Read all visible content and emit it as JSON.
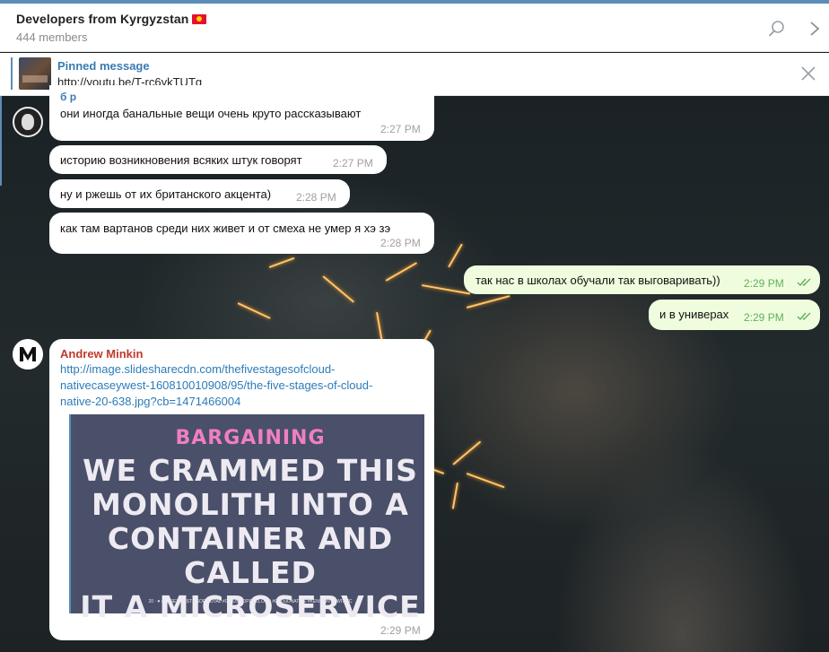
{
  "header": {
    "title": "Developers from Kyrgyzstan",
    "members": "444 members",
    "flag_color": "#e8112d"
  },
  "pinned": {
    "title": "Pinned message",
    "text": "http://youtu.be/T-rc6ykTUTg"
  },
  "messages": [
    {
      "sender_partial": "б р",
      "text": "они иногда банальные вещи очень круто рассказывают",
      "time": "2:27 PM"
    },
    {
      "text": "историю возникновения всяких штук говорят",
      "time": "2:27 PM"
    },
    {
      "text": "ну и ржешь от их британского акцента)",
      "time": "2:28 PM"
    },
    {
      "text": "как там вартанов среди них живет и от смеха не умер я хэ зэ",
      "time": "2:28 PM"
    },
    {
      "text": "так нас в школах обучали так выговаривать))",
      "time": "2:29 PM",
      "outgoing": true
    },
    {
      "text": "и в универах",
      "time": "2:29 PM",
      "outgoing": true
    },
    {
      "sender": "Andrew Minkin",
      "link_lines": [
        "http://image.slidesharecdn.com/thefivestagesofcloud-",
        "nativecaseywest-160810010908/95/the-five-stages-of-cloud-",
        "native-20-638.jpg?cb=1471466004"
      ],
      "preview": {
        "title": "BARGAINING",
        "body_lines": [
          "WE CRAMMED THIS",
          "MONOLITH INTO A",
          "CONTAINER AND CALLED",
          "IT A MICROSERVICE"
        ],
        "footer": "20 · ♥ #CASEYWEST #GOPIVOTAL #GIBUS #OPENCLOUD #CLOUDNATIVE #KENSHIN #TWITPIC"
      },
      "time": "2:29 PM"
    }
  ],
  "colors": {
    "accent": "#5b8db8",
    "outgoing_bubble": "#effdde",
    "sender_name": "#c0392b",
    "link": "#2c7bb8"
  }
}
